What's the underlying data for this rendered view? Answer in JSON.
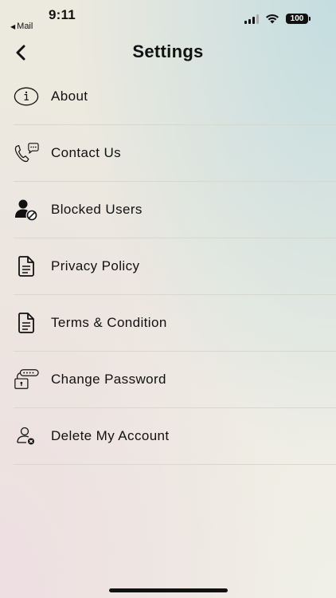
{
  "status_bar": {
    "time": "9:11",
    "back_app": "Mail",
    "battery": "100"
  },
  "header": {
    "title": "Settings"
  },
  "menu": {
    "items": [
      {
        "label": "About",
        "icon": "info-icon"
      },
      {
        "label": "Contact Us",
        "icon": "phone-chat-icon"
      },
      {
        "label": "Blocked Users",
        "icon": "blocked-user-icon"
      },
      {
        "label": "Privacy Policy",
        "icon": "document-icon"
      },
      {
        "label": "Terms & Condition",
        "icon": "document-icon"
      },
      {
        "label": "Change Password",
        "icon": "password-lock-icon"
      },
      {
        "label": "Delete My Account",
        "icon": "delete-user-icon"
      }
    ]
  }
}
